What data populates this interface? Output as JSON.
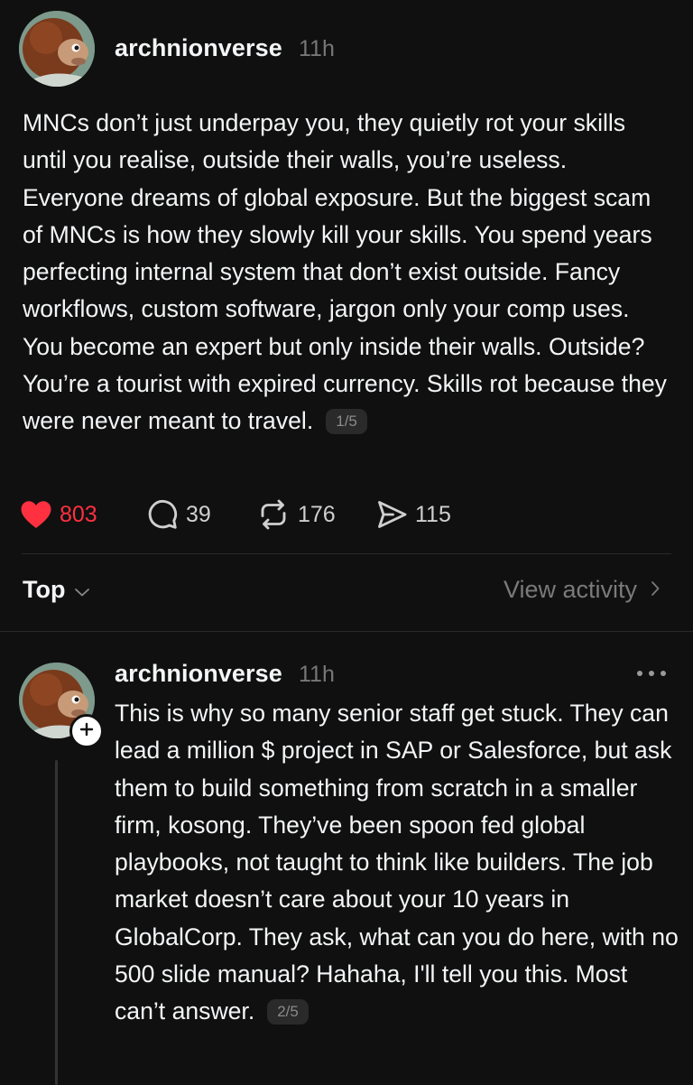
{
  "post": {
    "username": "archnionverse",
    "time": "11h",
    "text": "MNCs don’t just underpay you, they quietly rot your skills until you realise, outside their walls, you’re useless. Everyone dreams of global exposure. But the biggest scam of MNCs is how they slowly kill your skills. You spend years perfecting internal system that don’t exist outside. Fancy workflows, custom software, jargon only your comp uses. You become an expert but only inside their walls. Outside? You’re a tourist with expired currency. Skills rot because they were never meant to travel.",
    "page_indicator": "1/5",
    "likes": "803",
    "replies": "39",
    "reposts": "176",
    "shares": "115"
  },
  "replies_header": {
    "sort_label": "Top",
    "view_activity_label": "View activity"
  },
  "reply": {
    "username": "archnionverse",
    "time": "11h",
    "text": "This is why so many senior staff get stuck. They can lead a million $ project in SAP or Salesforce, but ask them to build something from scratch in a smaller firm, kosong. They’ve been spoon fed global playbooks, not taught to think like builders. The job market doesn’t care about your 10 years in GlobalCorp. They ask, what can you do here, with no 500 slide manual? Hahaha, I'll tell you this. Most can’t answer.",
    "page_indicator": "2/5"
  },
  "colors": {
    "background": "#101010",
    "text_primary": "#f3f5f7",
    "text_secondary": "#777777",
    "like_red": "#ff3040",
    "divider": "#2a2a2a"
  },
  "icons": {
    "like": "heart-filled-icon",
    "reply": "speech-bubble-icon",
    "repost": "repost-arrows-icon",
    "share": "send-paper-plane-icon",
    "sort": "chevron-down-icon",
    "activity": "chevron-right-icon",
    "follow": "plus-icon",
    "more": "more-dots-icon"
  }
}
